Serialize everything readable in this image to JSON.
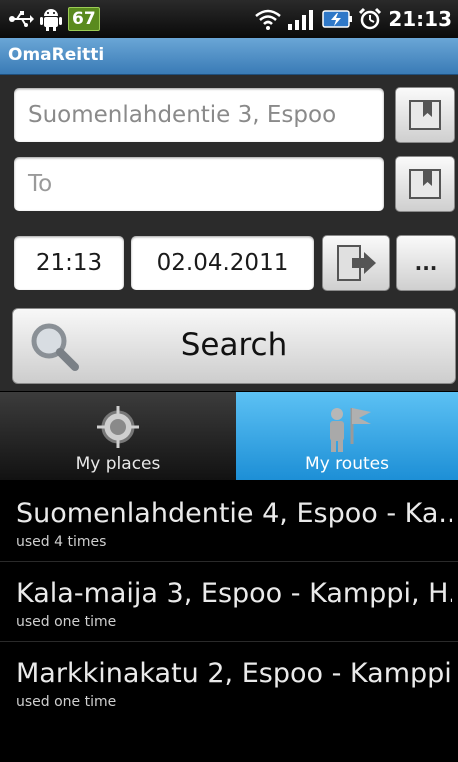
{
  "status_bar": {
    "badge": "67",
    "time": "21:13",
    "icons": [
      "usb-icon",
      "android-icon",
      "wifi-icon",
      "signal-icon",
      "battery-icon",
      "alarm-icon"
    ]
  },
  "app": {
    "title": "OmaReitti"
  },
  "form": {
    "from_value": "Suomenlahdentie 3, Espoo",
    "to_placeholder": "To",
    "time_value": "21:13",
    "date_value": "02.04.2011",
    "more_label": "...",
    "search_label": "Search"
  },
  "tabs": [
    {
      "label": "My places",
      "selected": false
    },
    {
      "label": "My routes",
      "selected": true
    }
  ],
  "routes": [
    {
      "title": "Suomenlahdentie 4, Espoo - Ka...",
      "usage": "used 4 times"
    },
    {
      "title": "Kala-maija 3, Espoo - Kamppi, H...",
      "usage": "used one time"
    },
    {
      "title": "Markkinakatu 2, Espoo - Kamppi...",
      "usage": "used one time"
    }
  ],
  "colors": {
    "accent": "#3a7bb6",
    "tab_selected": "#1d8fd6"
  }
}
